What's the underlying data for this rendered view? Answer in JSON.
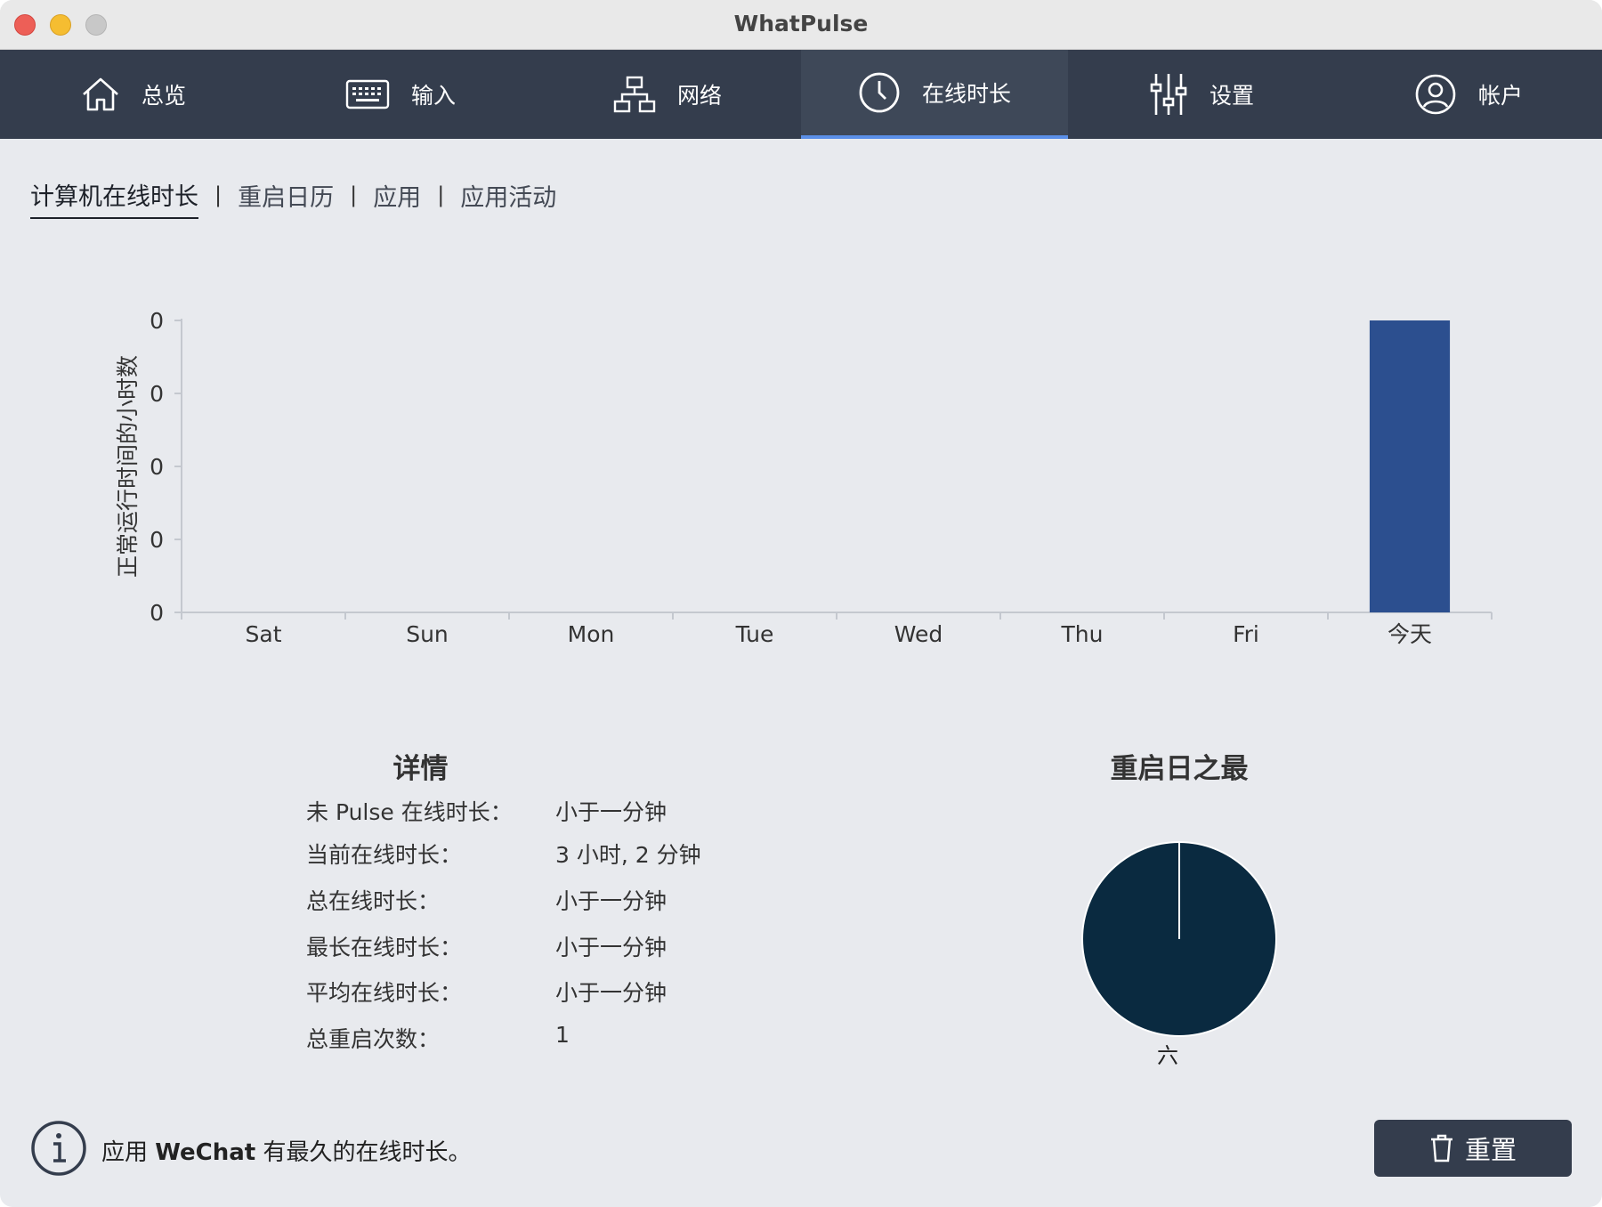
{
  "window": {
    "title": "WhatPulse"
  },
  "nav": {
    "items": [
      {
        "label": "总览",
        "icon": "home-icon"
      },
      {
        "label": "输入",
        "icon": "keyboard-icon"
      },
      {
        "label": "网络",
        "icon": "network-icon"
      },
      {
        "label": "在线时长",
        "icon": "clock-icon",
        "active": true
      },
      {
        "label": "设置",
        "icon": "sliders-icon"
      },
      {
        "label": "帐户",
        "icon": "user-icon"
      }
    ]
  },
  "subtabs": {
    "items": [
      {
        "label": "计算机在线时长",
        "active": true
      },
      {
        "label": "重启日历"
      },
      {
        "label": "应用"
      },
      {
        "label": "应用活动"
      }
    ],
    "separator": "|"
  },
  "chart_data": [
    {
      "type": "bar",
      "ylabel": "正常运行时间的小时数",
      "xlabel": "",
      "categories": [
        "Sat",
        "Sun",
        "Mon",
        "Tue",
        "Wed",
        "Thu",
        "Fri",
        "今天"
      ],
      "values": [
        0,
        0,
        0,
        0,
        0,
        0,
        0,
        1
      ],
      "ytick_labels": [
        "0",
        "0",
        "0",
        "0",
        "0"
      ],
      "ylim": [
        0,
        1
      ],
      "grid": false,
      "bar_color": "#2c4f8f"
    },
    {
      "type": "pie",
      "title": "重启日之最",
      "labels": [
        "六"
      ],
      "values": [
        1
      ],
      "color": "#0a2a40"
    }
  ],
  "details": {
    "title": "详情",
    "rows": [
      {
        "label": "未 Pulse 在线时长：",
        "value": "小于一分钟"
      },
      {
        "label": "当前在线时长：",
        "value": "3 小时, 2 分钟"
      },
      {
        "label": "总在线时长：",
        "value": "小于一分钟"
      },
      {
        "label": "最长在线时长：",
        "value": "小于一分钟"
      },
      {
        "label": "平均在线时长：",
        "value": "小于一分钟"
      },
      {
        "label": "总重启次数：",
        "value": "1"
      }
    ]
  },
  "footer": {
    "info_prefix": "应用 ",
    "info_app": "WeChat",
    "info_suffix": " 有最久的在线时长。",
    "reset_label": "重置"
  },
  "colors": {
    "nav_bg": "#343d4d",
    "nav_active_underline": "#5b8fe8",
    "bar": "#2c4f8f",
    "pie": "#0a2a40",
    "background": "#e8eaee"
  }
}
